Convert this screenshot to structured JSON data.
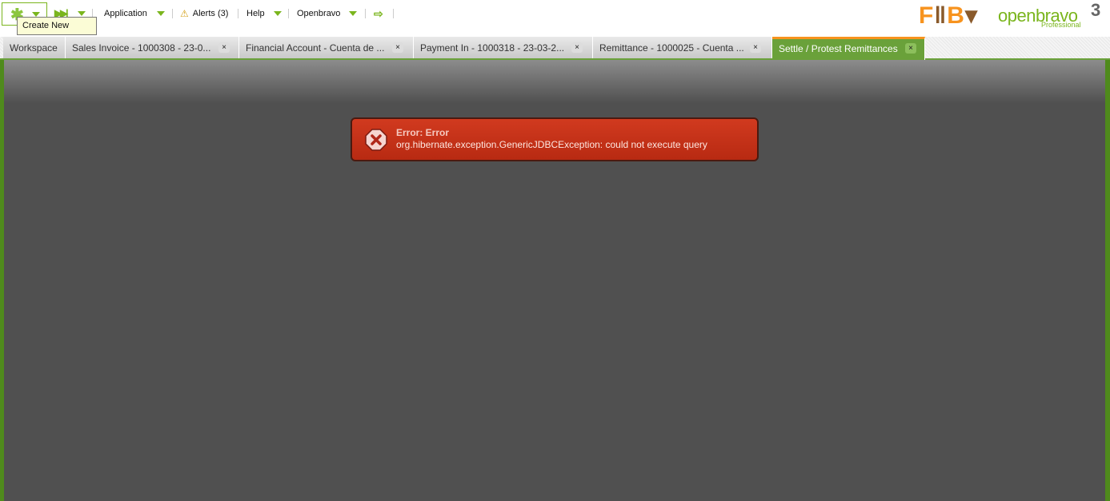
{
  "toolbar": {
    "tooltip": "Create New",
    "application": "Application",
    "alerts": "Alerts (3)",
    "help": "Help",
    "user": "Openbravo"
  },
  "logos": {
    "customer": "F+B",
    "brand": "openbravo",
    "edition": "Professional",
    "version": "3"
  },
  "tabs": [
    {
      "label": "Workspace",
      "closable": false
    },
    {
      "label": "Sales Invoice - 1000308 - 23-0...",
      "closable": true
    },
    {
      "label": "Financial Account - Cuenta de ...",
      "closable": true
    },
    {
      "label": "Payment In - 1000318 - 23-03-2...",
      "closable": true
    },
    {
      "label": "Remittance - 1000025 - Cuenta ...",
      "closable": true
    },
    {
      "label": "Settle / Protest Remittances",
      "closable": true,
      "active": true
    }
  ],
  "close_glyph": "×",
  "error": {
    "title": "Error: Error",
    "message": "org.hibernate.exception.GenericJDBCException: could not execute query"
  }
}
